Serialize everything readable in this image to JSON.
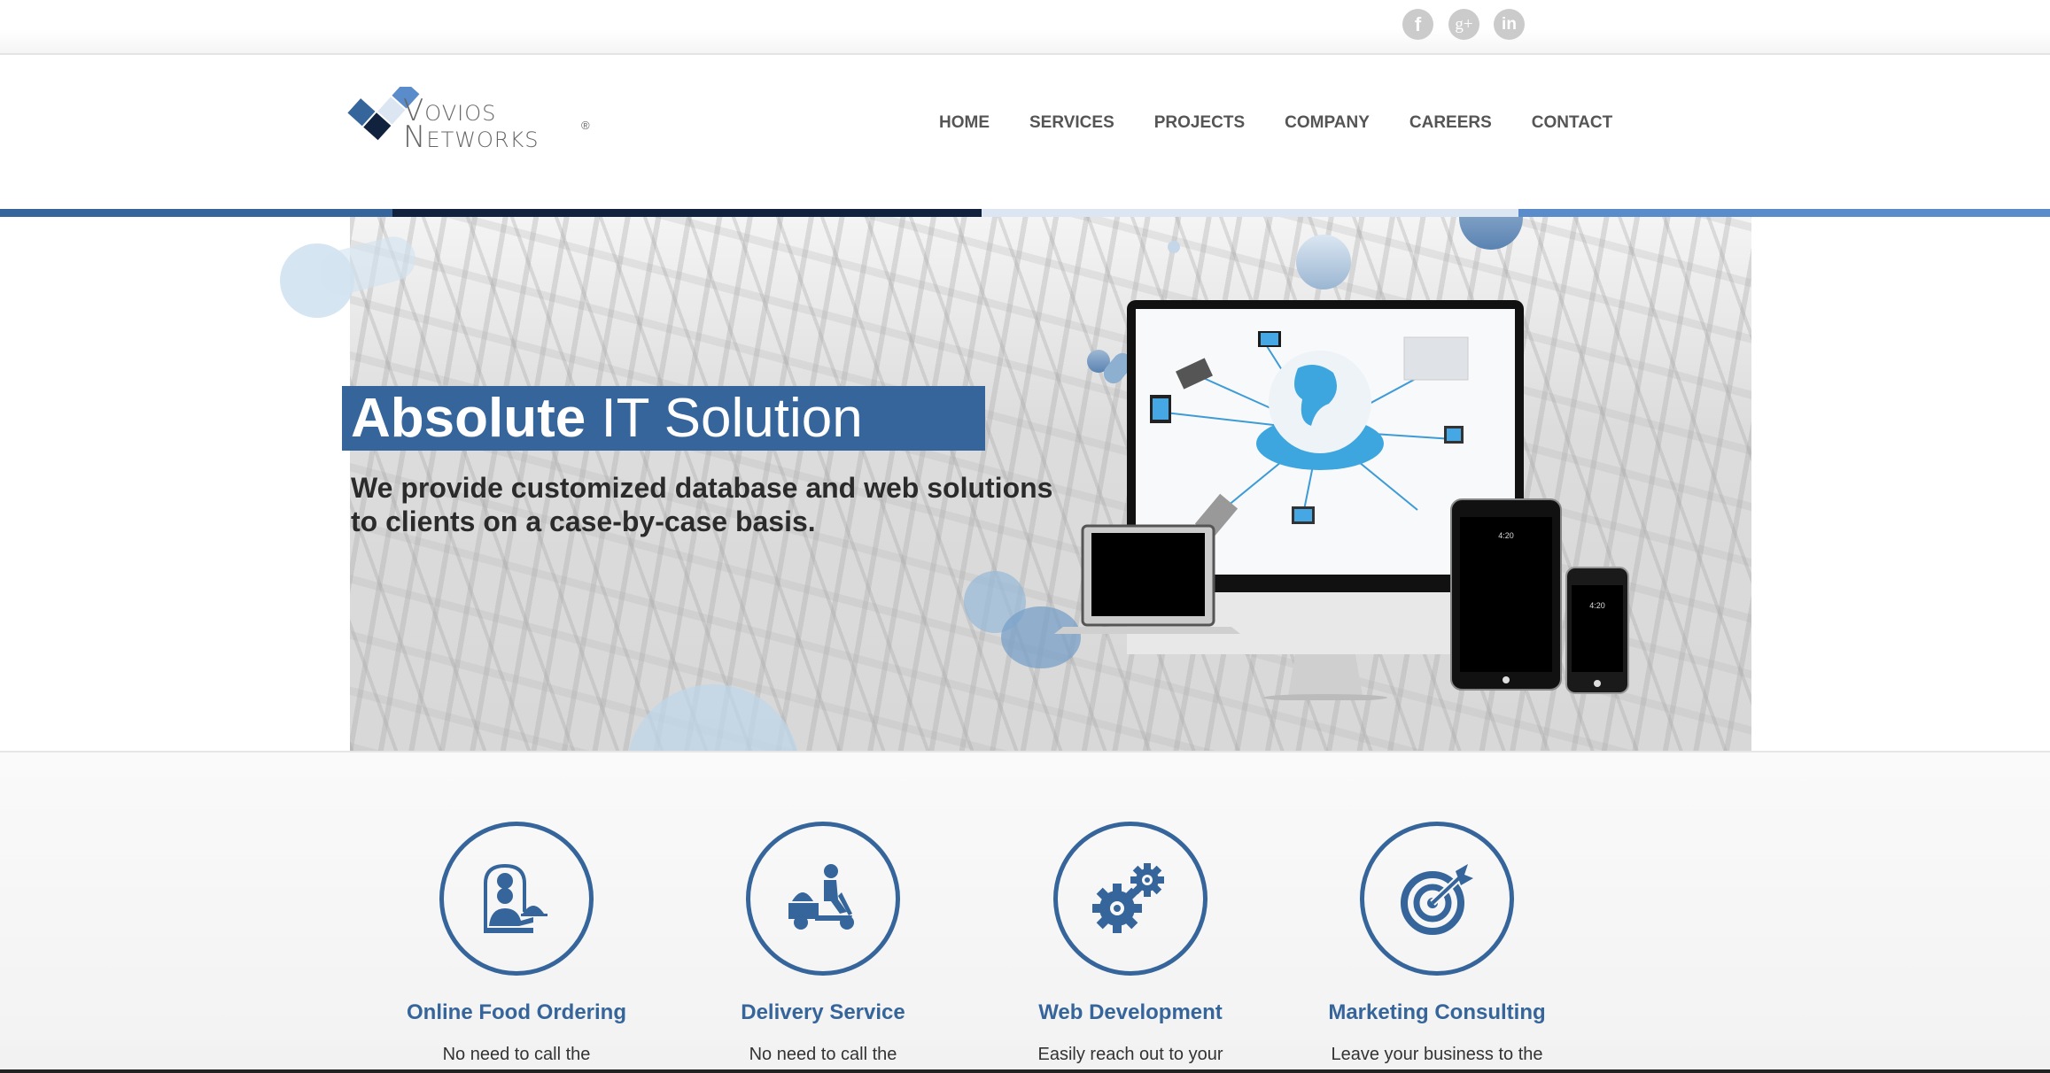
{
  "social": {
    "items": [
      {
        "name": "facebook",
        "glyph": "f"
      },
      {
        "name": "google-plus",
        "glyph": "g+"
      },
      {
        "name": "linkedin",
        "glyph": "in"
      }
    ]
  },
  "header": {
    "logo": {
      "line1": "Vovios",
      "line2": "Networks",
      "registered": "®",
      "colors": [
        "#35659a",
        "#10223d",
        "#dbe6f2",
        "#5a8ccb"
      ]
    },
    "nav": [
      {
        "label": "HOME"
      },
      {
        "label": "SERVICES"
      },
      {
        "label": "PROJECTS"
      },
      {
        "label": "COMPANY"
      },
      {
        "label": "CAREERS"
      },
      {
        "label": "CONTACT"
      }
    ]
  },
  "stripe_colors": [
    "#35659a",
    "#10223d",
    "#dbe6f2",
    "#5a8ccb"
  ],
  "hero": {
    "title_bold": "Absolute",
    "title_light": " IT Solution",
    "subtitle_line1": "We provide customized database and web solutions",
    "subtitle_line2": "to clients on a case-by-case basis.",
    "device_time_tablet": "4:20",
    "device_time_phone": "4:20"
  },
  "services": [
    {
      "icon": "chef-serving-icon",
      "title": "Online Food Ordering",
      "desc": "No need to call the"
    },
    {
      "icon": "delivery-scooter-icon",
      "title": "Delivery Service",
      "desc": "No need to call the"
    },
    {
      "icon": "gears-icon",
      "title": "Web Development",
      "desc": "Easily reach out to your"
    },
    {
      "icon": "target-arrow-icon",
      "title": "Marketing Consulting",
      "desc": "Leave your business to the"
    }
  ],
  "theme": {
    "accent": "#35659a",
    "nav_text": "#555555",
    "social_bg": "#cbcbcb"
  }
}
